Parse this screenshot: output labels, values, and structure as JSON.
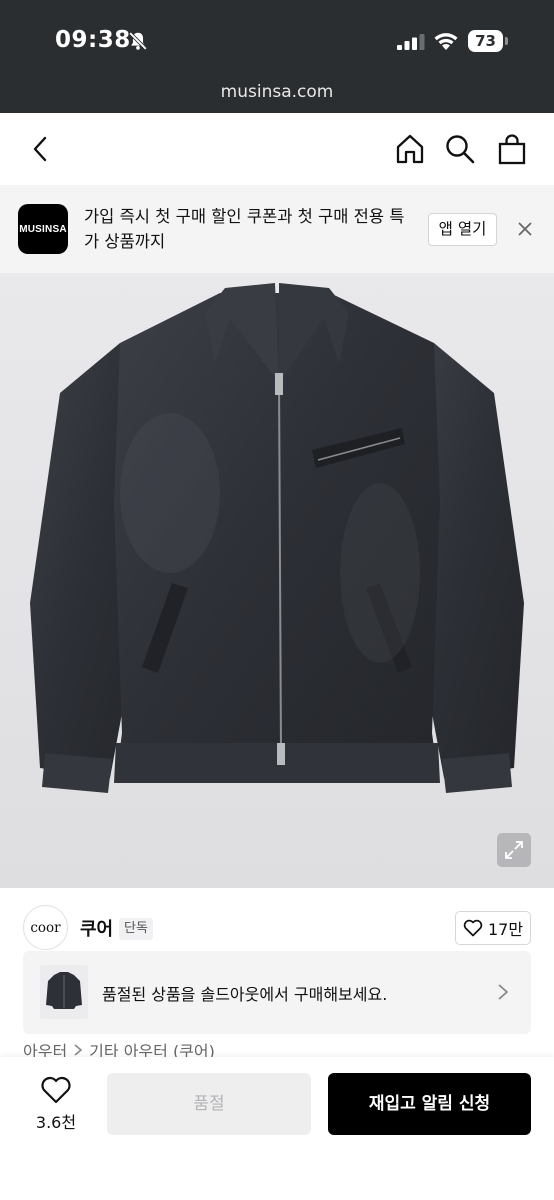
{
  "status_bar": {
    "time": "09:38",
    "battery": "73",
    "icons": [
      "bell-off-icon",
      "signal-icon",
      "wifi-icon",
      "battery-icon"
    ]
  },
  "browser": {
    "url": "musinsa.com"
  },
  "header": {
    "icons": [
      "back-icon",
      "home-icon",
      "search-icon",
      "cart-icon"
    ]
  },
  "app_banner": {
    "logo_text": "MUSINSA",
    "message": "가입 즉시 첫 구매 할인 쿠폰과 첫 구매 전용 특가 상품까지",
    "open_button": "앱 열기",
    "close_icon": "close-icon"
  },
  "product": {
    "image_alt": "black denim zip-up jacket",
    "expand_icon": "expand-icon",
    "brand_logo_text": "coor",
    "brand_name": "쿠어",
    "badge": "단독",
    "like_count": "17만",
    "soldout_message": "품절된 상품을 솔드아웃에서 구매해보세요.",
    "category": [
      "아우터",
      "기타 아우터 (쿠어)"
    ]
  },
  "bottom_bar": {
    "wish_count": "3.6천",
    "soldout_label": "품절",
    "restock_label": "재입고 알림 신청"
  },
  "colors": {
    "status_bg": "#2b2e31",
    "banner_bg": "#f4f4f5",
    "primary_button": "#000000",
    "disabled_button": "#eeeeef"
  }
}
